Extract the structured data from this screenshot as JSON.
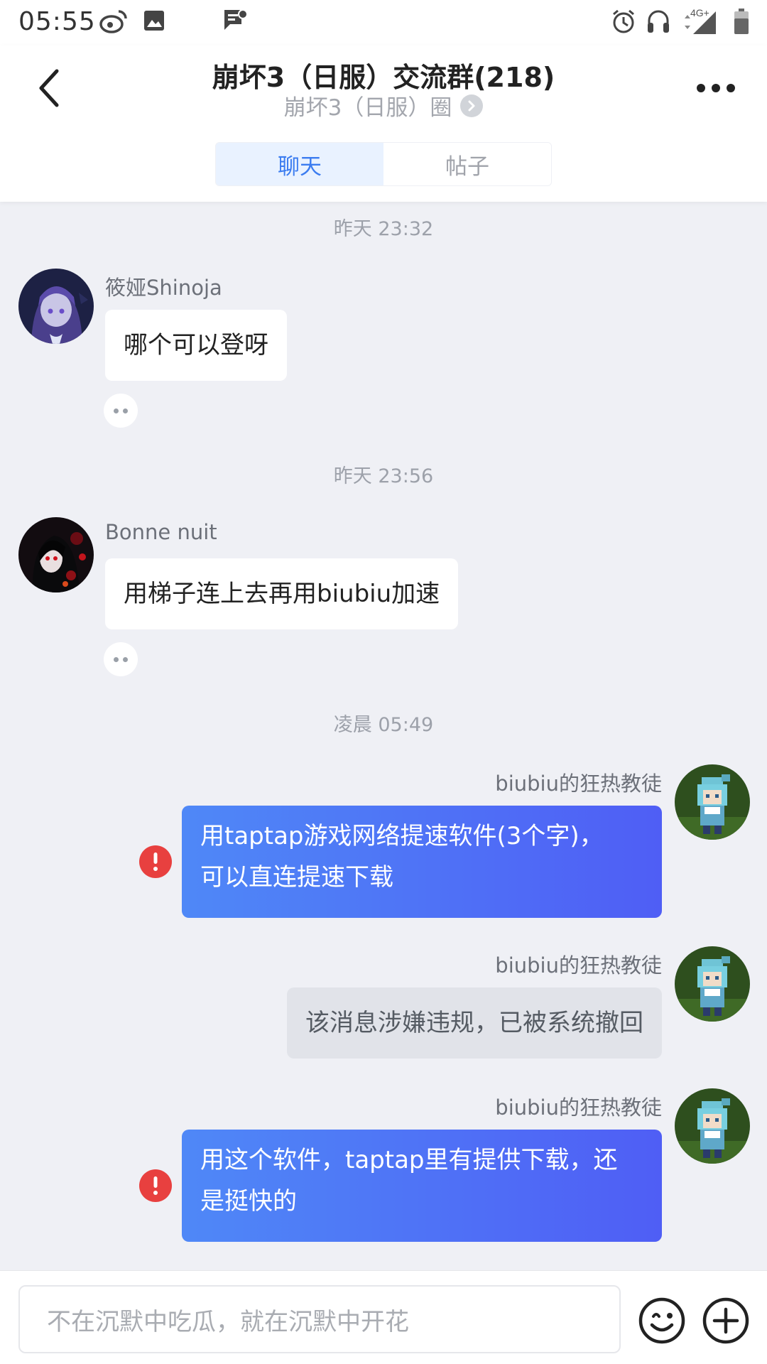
{
  "status_bar": {
    "time": "05:55",
    "network": "4G+",
    "icons": [
      "weibo-icon",
      "image-icon",
      "notification-icon",
      "alarm-icon",
      "headset-icon",
      "signal-icon",
      "battery-icon"
    ]
  },
  "header": {
    "title": "崩坏3（日服）交流群(218)",
    "subtitle": "崩坏3（日服）圈",
    "tabs": [
      {
        "label": "聊天",
        "active": true
      },
      {
        "label": "帖子",
        "active": false
      }
    ]
  },
  "messages": [
    {
      "timestamp": "昨天 23:32",
      "sender": "筱娅Shinoja",
      "text": "哪个可以登呀"
    },
    {
      "timestamp": "昨天 23:56",
      "sender": "Bonne nuit",
      "text": "用梯子连上去再用biubiu加速"
    },
    {
      "timestamp": "凌晨 05:49",
      "sender": "biubiu的狂热教徒",
      "text_line1": "用taptap游戏网络提速软件(3个字)，",
      "text_line2": "可以直连提速下载",
      "failed": true
    },
    {
      "sender": "biubiu的狂热教徒",
      "text": "该消息涉嫌违规，已被系统撤回",
      "recalled": true
    },
    {
      "sender": "biubiu的狂热教徒",
      "text_line1": "用这个软件，taptap里有提供下载，还",
      "text_line2": "是挺快的",
      "failed": true
    }
  ],
  "input": {
    "placeholder": "不在沉默中吃瓜，就在沉默中开花"
  },
  "colors": {
    "accent": "#3b7cf0",
    "bubble_gradient_start": "#4f88f7",
    "bubble_gradient_end": "#4f5ef5",
    "error_red": "#e8403f",
    "chat_background": "#eff0f5"
  }
}
